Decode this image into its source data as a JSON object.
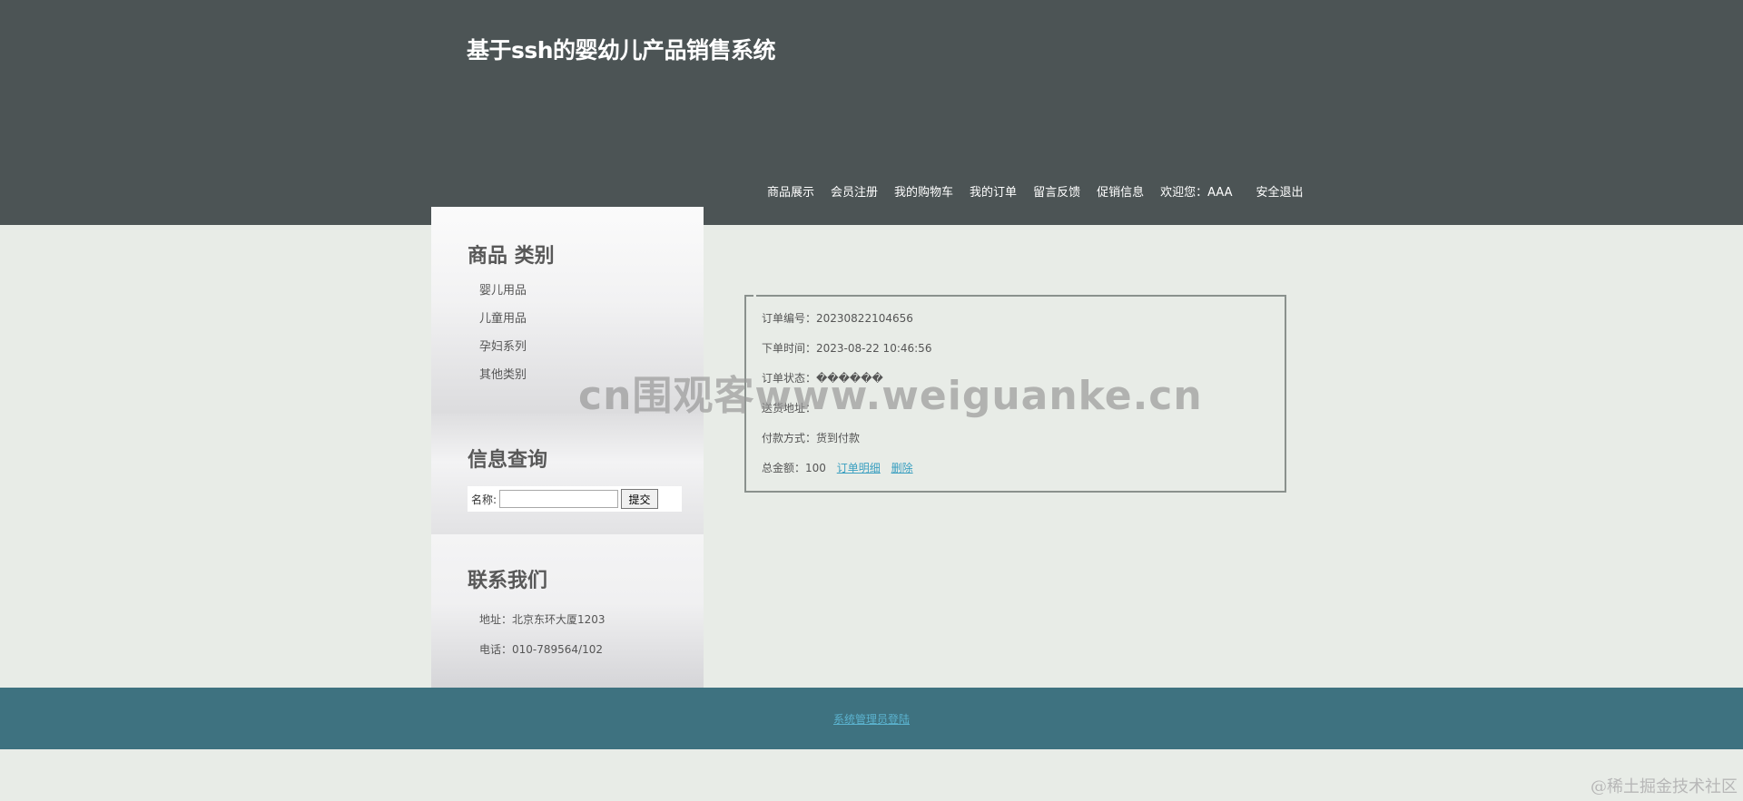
{
  "header": {
    "site_title": "基于ssh的婴幼儿产品销售系统",
    "nav": {
      "products": "商品展示",
      "register": "会员注册",
      "cart": "我的购物车",
      "orders": "我的订单",
      "feedback": "留言反馈",
      "promotions": "促销信息",
      "welcome": "欢迎您：AAA",
      "logout": "安全退出"
    }
  },
  "sidebar": {
    "categories": {
      "heading": "商品 类别",
      "items": [
        "婴儿用品",
        "儿童用品",
        "孕妇系列",
        "其他类别"
      ]
    },
    "search": {
      "heading": "信息查询",
      "label": "名称:",
      "value": "",
      "submit": "提交"
    },
    "contact": {
      "heading": "联系我们",
      "address": "地址：北京东环大厦1203",
      "phone": "电话：010-789564/102"
    }
  },
  "order": {
    "number": "订单编号：20230822104656",
    "time": "下单时间：2023-08-22 10:46:56",
    "status": "订单状态：������",
    "address": "送货地址：",
    "payment": "付款方式：货到付款",
    "total": "总金额：100",
    "detail_link": "订单明细",
    "delete_link": "删除"
  },
  "footer": {
    "admin_link": "系统管理员登陆"
  },
  "watermarks": {
    "main": "cn围观客www.weiguanke.cn",
    "corner": "@稀土掘金技术社区"
  },
  "colors": {
    "header_bg": "#4c5455",
    "page_bg": "#e8ece7",
    "footer_bg": "#3e7280",
    "link": "#3a9fc0"
  }
}
